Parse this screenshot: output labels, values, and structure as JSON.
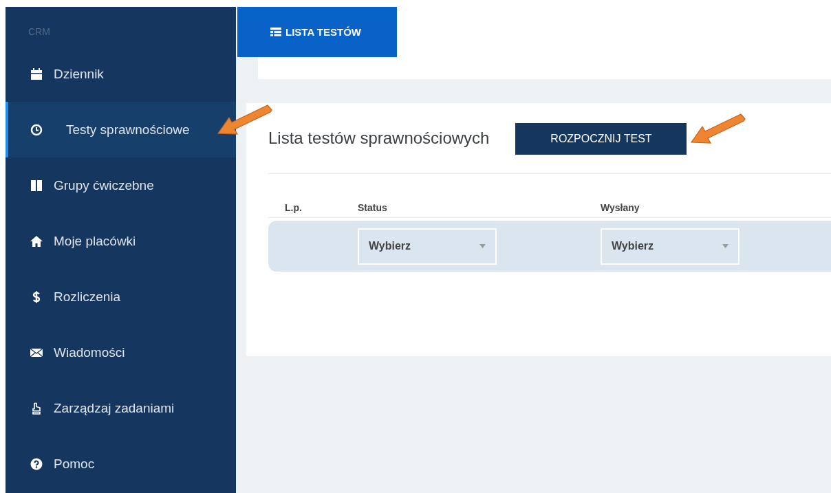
{
  "sidebar": {
    "section_label": "CRM",
    "items": [
      {
        "label": "Dziennik",
        "selected": false,
        "highlighted": false
      },
      {
        "label": "Testy sprawnościowe",
        "selected": true,
        "highlighted": true
      },
      {
        "label": "Grupy ćwiczebne",
        "selected": false,
        "highlighted": false
      },
      {
        "label": "Moje placówki",
        "selected": false,
        "highlighted": false
      },
      {
        "label": "Rozliczenia",
        "selected": false,
        "highlighted": false
      },
      {
        "label": "Wiadomości",
        "selected": false,
        "highlighted": false
      },
      {
        "label": "Zarządzaj zadaniami",
        "selected": false,
        "highlighted": false
      },
      {
        "label": "Pomoc",
        "selected": false,
        "highlighted": false
      }
    ]
  },
  "tabs": [
    {
      "label": "LISTA TESTÓW",
      "selected": true
    }
  ],
  "card": {
    "title": "Lista testów sprawnościowych",
    "action_button": {
      "label": "ROZPOCZNIJ TEST",
      "highlighted": true
    },
    "table": {
      "columns": [
        {
          "label": "L.p."
        },
        {
          "label": "Status",
          "filter": "Wybierz"
        },
        {
          "label": "Wysłany",
          "filter": "Wybierz"
        }
      ]
    }
  }
}
